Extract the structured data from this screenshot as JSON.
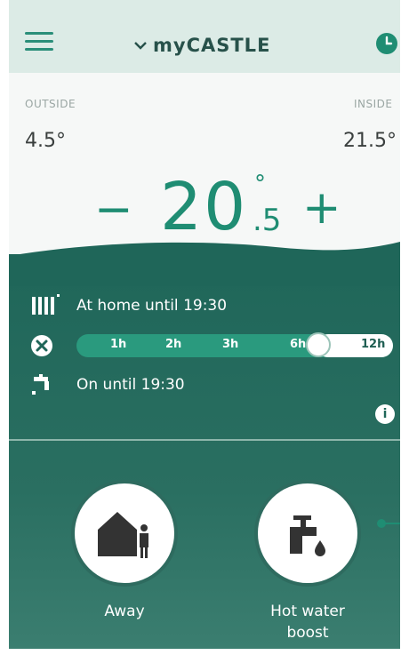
{
  "header": {
    "title": "myCASTLE"
  },
  "temps": {
    "outside_label": "OUTSIDE",
    "outside_value": "4.5°",
    "inside_label": "INSIDE",
    "inside_value": "21.5°"
  },
  "setpoint": {
    "minus": "−",
    "whole": "20",
    "degree": "°",
    "fraction": ".5",
    "plus": "+"
  },
  "status": {
    "heating_text": "At home until 19:30",
    "water_text": "On until 19:30"
  },
  "slider": {
    "ticks": [
      "1h",
      "2h",
      "3h",
      "6h",
      "12h"
    ],
    "selected": "6h"
  },
  "actions": {
    "away_label": "Away",
    "hotwater_label_line1": "Hot water",
    "hotwater_label_line2": "boost"
  },
  "icons": {
    "menu": "hamburger-icon",
    "dropdown": "chevron-down-icon",
    "schedule": "clock-icon",
    "radiator": "radiator-icon",
    "cancel": "close-circle-icon",
    "tap": "tap-icon",
    "info": "info-icon",
    "away": "house-person-icon",
    "hot_water": "faucet-drop-icon"
  },
  "colors": {
    "accent": "#1f8d73",
    "header_bg": "#dcebe6",
    "dark_panel": "#1f6659"
  },
  "info_glyph": "i"
}
